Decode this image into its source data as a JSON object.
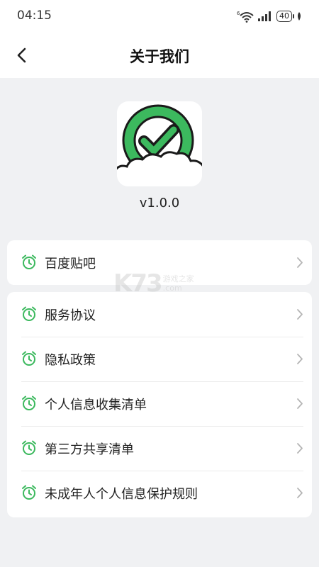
{
  "status_bar": {
    "time": "04:15",
    "network_label": "6",
    "battery": "40"
  },
  "header": {
    "title": "关于我们"
  },
  "app": {
    "version": "v1.0.0",
    "logo_colors": {
      "ring": "#3cb95e",
      "outline": "#1a1a1a"
    }
  },
  "menu": {
    "group1": [
      {
        "label": "百度贴吧",
        "icon": "alarm-clock-icon"
      }
    ],
    "group2": [
      {
        "label": "服务协议",
        "icon": "alarm-clock-icon"
      },
      {
        "label": "隐私政策",
        "icon": "alarm-clock-icon"
      },
      {
        "label": "个人信息收集清单",
        "icon": "alarm-clock-icon"
      },
      {
        "label": "第三方共享清单",
        "icon": "alarm-clock-icon"
      },
      {
        "label": "未成年人个人信息保护规则",
        "icon": "alarm-clock-icon"
      }
    ]
  },
  "watermark": {
    "logo": "K73",
    "text_top": "游戏之家",
    "text_bottom": ".com"
  },
  "colors": {
    "accent": "#3cb95e",
    "background": "#f0f1f3"
  }
}
